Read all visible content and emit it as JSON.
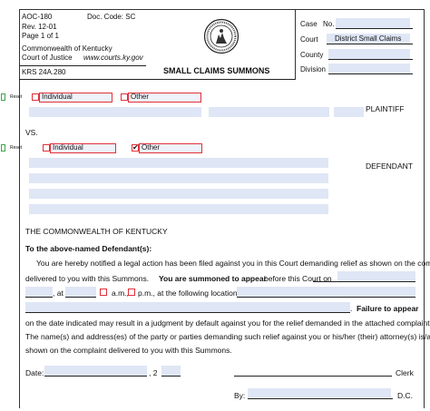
{
  "header": {
    "form_no": "AOC-180",
    "doc_code": "Doc. Code: SC",
    "rev": "Rev. 12-01",
    "page": "Page 1 of 1",
    "commonwealth": "Commonwealth of Kentucky",
    "court_of_justice": "Court of Justice",
    "website": "www.courts.ky.gov",
    "statute": "KRS 24A.280",
    "title": "SMALL CLAIMS SUMMONS"
  },
  "case_info": {
    "case_label": "Case",
    "case_no_label": "No.",
    "court_label": "Court",
    "court_value": "District Small Claims",
    "county_label": "County",
    "division_label": "Division"
  },
  "plaintiff": {
    "reset_label": "Reset",
    "individual_label": "Individual",
    "other_label": "Other",
    "individual_checked": false,
    "other_checked": false,
    "role_label": "PLAINTIFF"
  },
  "vs_label": "VS.",
  "defendant": {
    "reset_label": "Reset",
    "individual_label": "Individual",
    "other_label": "Other",
    "individual_checked": false,
    "other_checked": true,
    "check_glyph": "✔",
    "role_label": "DEFENDANT"
  },
  "body": {
    "commonwealth_heading": "THE COMMONWEALTH OF KENTUCKY",
    "to_defendant": "To the above-named Defendant(s):",
    "para1_line1": "You are hereby notified a legal action has been filed against you in this Court demanding relief as shown on the complaint",
    "para1_line2a": "delivered to you with this Summons.",
    "para1_line2b": "You are summoned to appear",
    "para1_line2c": "before this Court on",
    "comma": ",",
    "at_label": ", at",
    "am_label": "a.m.,",
    "pm_label": "p.m., at the following location:",
    "period": ".",
    "failure_label": "Failure to appear",
    "para2_line1": "on the date indicated may result in a judgment by default against you for the relief demanded in the attached complaint.",
    "para3_line1": "The name(s) and address(es) of the party or parties demanding such relief against you or his/her (their) attorney(s) is/are",
    "para3_line2": "shown on the complaint delivered to you with this Summons."
  },
  "signature": {
    "date_label": "Date:",
    "year_prefix": ", 2",
    "clerk_label": "Clerk",
    "by_label": "By:",
    "dc_label": "D.C."
  }
}
